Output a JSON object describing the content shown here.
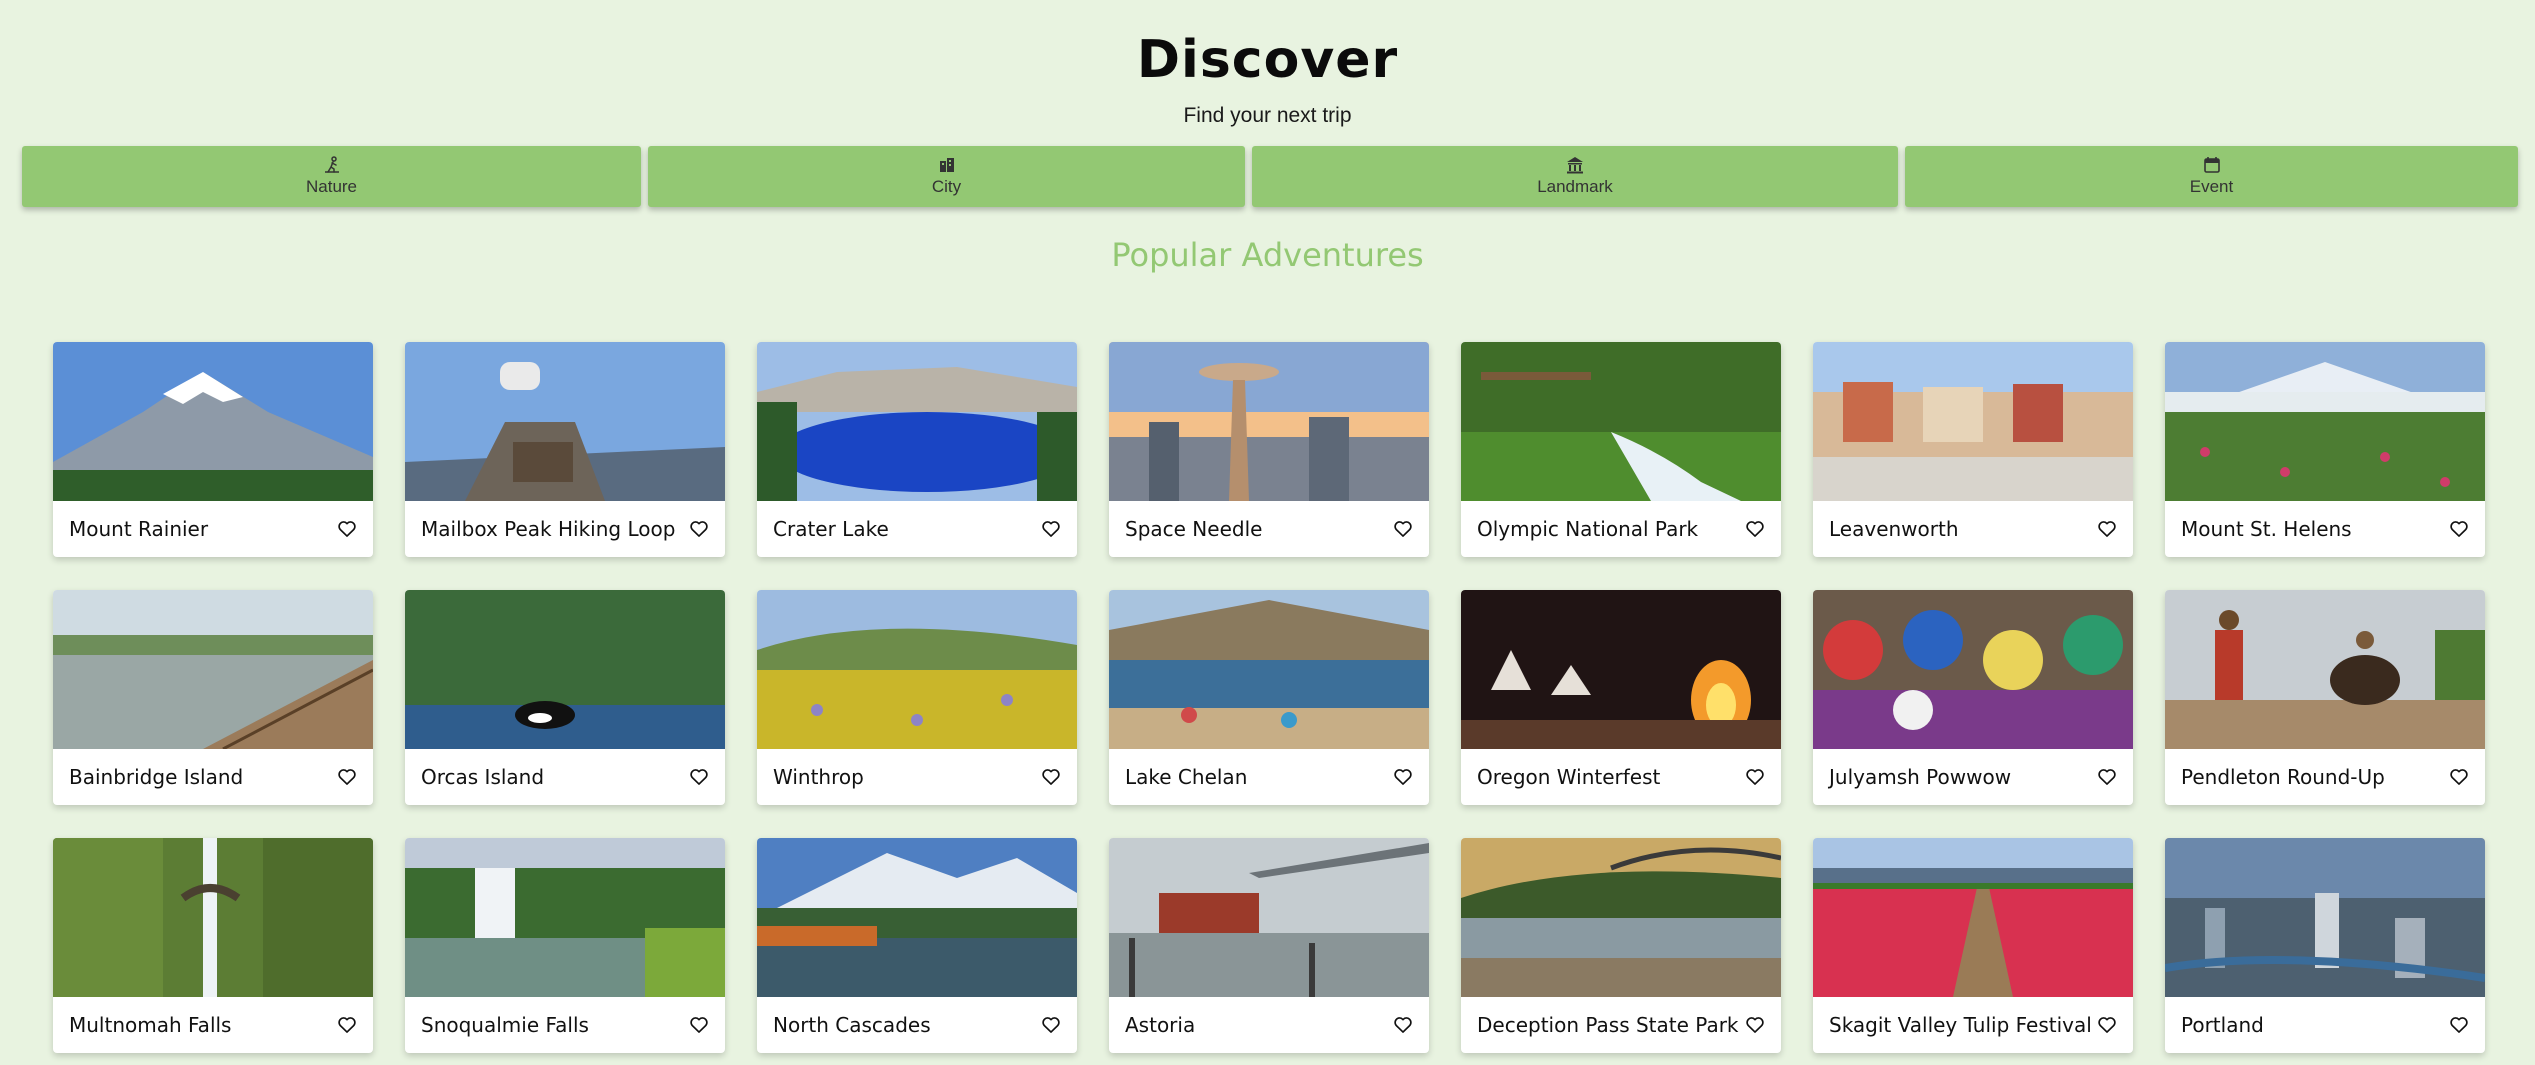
{
  "header": {
    "title": "Discover",
    "subtitle": "Find your next trip"
  },
  "categories": [
    {
      "label": "Nature",
      "icon": "hiking-icon"
    },
    {
      "label": "City",
      "icon": "city-icon"
    },
    {
      "label": "Landmark",
      "icon": "landmark-icon"
    },
    {
      "label": "Event",
      "icon": "calendar-icon"
    }
  ],
  "section_title": "Popular Adventures",
  "colors": {
    "background": "#e8f3e0",
    "accent": "#93c873",
    "card": "#ffffff"
  },
  "cards": [
    {
      "name": "Mount Rainier",
      "scene": "mountain"
    },
    {
      "name": "Mailbox Peak Hiking Loop",
      "scene": "mailbox"
    },
    {
      "name": "Crater Lake",
      "scene": "lake"
    },
    {
      "name": "Space Needle",
      "scene": "needle"
    },
    {
      "name": "Olympic National Park",
      "scene": "forest"
    },
    {
      "name": "Leavenworth",
      "scene": "village"
    },
    {
      "name": "Mount St. Helens",
      "scene": "meadow"
    },
    {
      "name": "Bainbridge Island",
      "scene": "marina"
    },
    {
      "name": "Orcas Island",
      "scene": "orca"
    },
    {
      "name": "Winthrop",
      "scene": "flowers"
    },
    {
      "name": "Lake Chelan",
      "scene": "beach"
    },
    {
      "name": "Oregon Winterfest",
      "scene": "fire"
    },
    {
      "name": "Julyamsh Powwow",
      "scene": "powwow"
    },
    {
      "name": "Pendleton Round-Up",
      "scene": "rodeo"
    },
    {
      "name": "Multnomah Falls",
      "scene": "falls"
    },
    {
      "name": "Snoqualmie Falls",
      "scene": "falls2"
    },
    {
      "name": "North Cascades",
      "scene": "cascades"
    },
    {
      "name": "Astoria",
      "scene": "bridge"
    },
    {
      "name": "Deception Pass State Park",
      "scene": "pass"
    },
    {
      "name": "Skagit Valley Tulip Festival",
      "scene": "tulips"
    },
    {
      "name": "Portland",
      "scene": "cityscape"
    }
  ]
}
